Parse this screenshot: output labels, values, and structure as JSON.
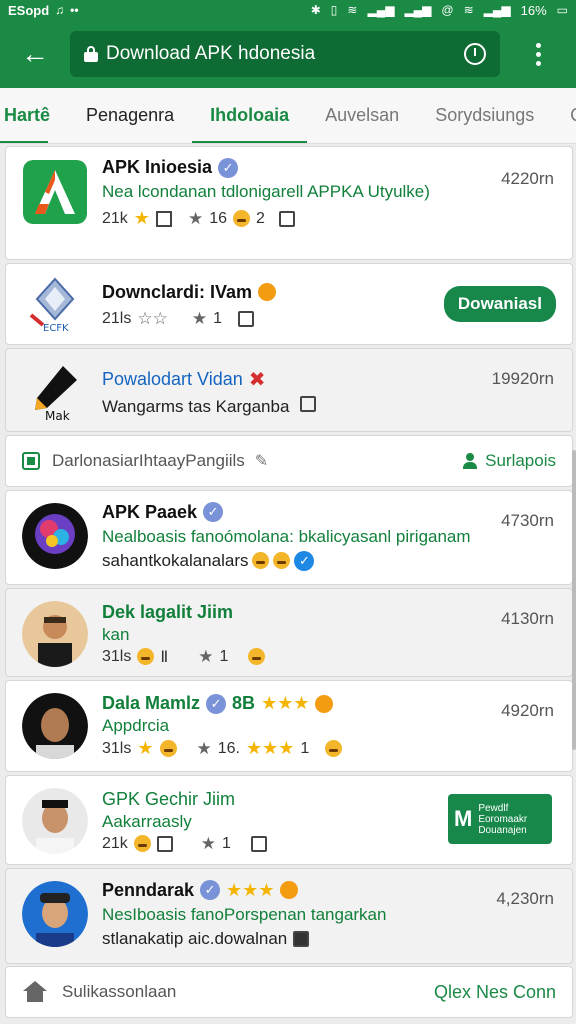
{
  "status_bar": {
    "left_text": "ESopd",
    "battery_percent": "16%"
  },
  "app_bar": {
    "url_text": "Download APK hdonesia"
  },
  "tabs": [
    {
      "label": "Hartê"
    },
    {
      "label": "Penagenra"
    },
    {
      "label": "Ihdoloaia"
    },
    {
      "label": "Auvelsan"
    },
    {
      "label": "Sorydsiungs"
    },
    {
      "label": "Qoo"
    }
  ],
  "apps": [
    {
      "title": "APK Inioesia",
      "size": "4220rn",
      "subtitle": "Nea lcondanan tdlonigarell APPKA Utyulke)",
      "stat1": "21k",
      "stat2": "16",
      "stat3": "2"
    },
    {
      "title": "Downclardi: IVam",
      "subtitle": "21ls",
      "stat": "1",
      "button": "Dowaniasl",
      "icon_label": "ECFK"
    },
    {
      "title": "Powalodart Vidan",
      "size": "19920rn",
      "subtitle": "Wangarms tas Karganba",
      "icon_label": "Mak"
    }
  ],
  "section": {
    "title": "DarlonasiarIhtaayPangiils",
    "action": "Surlapois"
  },
  "people": [
    {
      "title": "APK Paaek",
      "size": "4730rn",
      "line1": "Nealboasis fanoómolana: bkalicyasanl piriganam",
      "line2": "sahantkokalanalars"
    },
    {
      "title": "Dek lagalit Jiim",
      "size": "4130rn",
      "line1": "kan",
      "stat1": "31ls",
      "stat2": "1"
    },
    {
      "title": "Dala Mamlz",
      "size": "4920rn",
      "rating_prefix": "8B",
      "line1": "Appdrcia",
      "stat1": "31ls",
      "stat2": "16.",
      "stat3": "1"
    },
    {
      "title": "GPK Gechir Jiim",
      "line1": "Aakarraasly",
      "stat1": "21k",
      "stat2": "1",
      "button": "Pewdlf Eoromaakr Douanajen"
    },
    {
      "title": "Penndarak",
      "size": "4,230rn",
      "line1": "NesIboasis fanoPorspenan tangarkan",
      "line2": "stlanakatip aic.dowalnan"
    }
  ],
  "footer": {
    "label": "Sulikassonlaan",
    "action": "Qlex Nes Conn"
  }
}
